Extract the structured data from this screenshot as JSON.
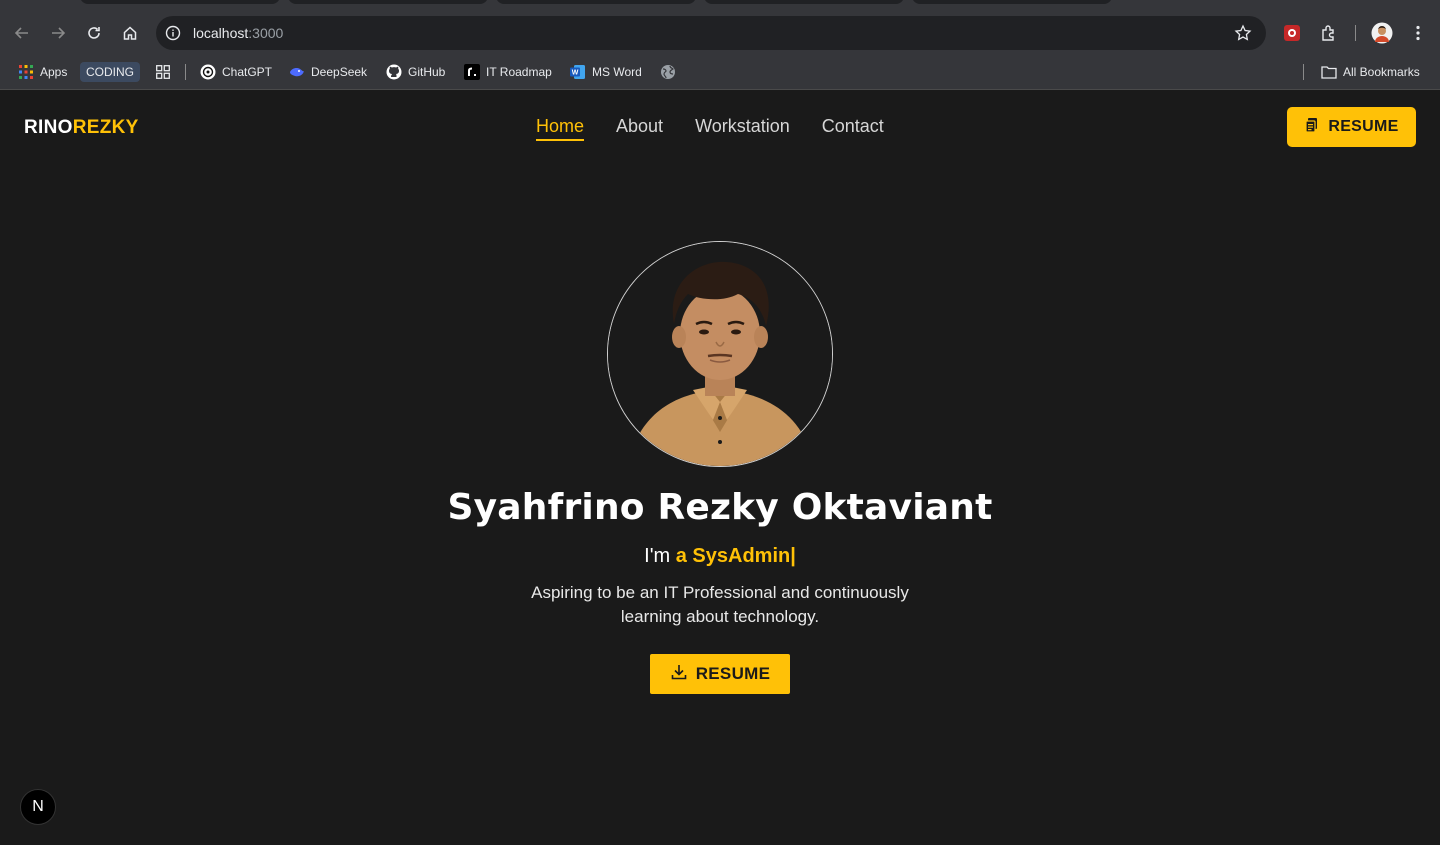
{
  "browser": {
    "url_host": "localhost",
    "url_port": ":3000",
    "bookmarks": {
      "apps": "Apps",
      "coding": "CODING",
      "chatgpt": "ChatGPT",
      "deepseek": "DeepSeek",
      "github": "GitHub",
      "itroadmap": "IT Roadmap",
      "msword": "MS Word",
      "all": "All Bookmarks"
    }
  },
  "site": {
    "logo_part1": "RINO",
    "logo_part2": "REZKY",
    "nav": {
      "home": "Home",
      "about": "About",
      "workstation": "Workstation",
      "contact": "Contact"
    },
    "header_resume": "RESUME",
    "name": "Syahfrino Rezky Oktaviant",
    "role_prefix": "I'm ",
    "role_highlight": "a SysAdmin|",
    "description": "Aspiring to be an IT Professional and continuously learning about technology.",
    "main_resume": "RESUME",
    "badge": "N"
  },
  "colors": {
    "accent": "#ffc107",
    "background": "#1a1a1a",
    "browser_chrome": "#35363a"
  },
  "icons": [
    "back-arrow-icon",
    "forward-arrow-icon",
    "reload-icon",
    "home-icon",
    "site-info-icon",
    "bookmark-star-icon",
    "extensions-icon",
    "profile-avatar-icon",
    "menu-kebab-icon",
    "resume-document-icon",
    "download-icon"
  ]
}
